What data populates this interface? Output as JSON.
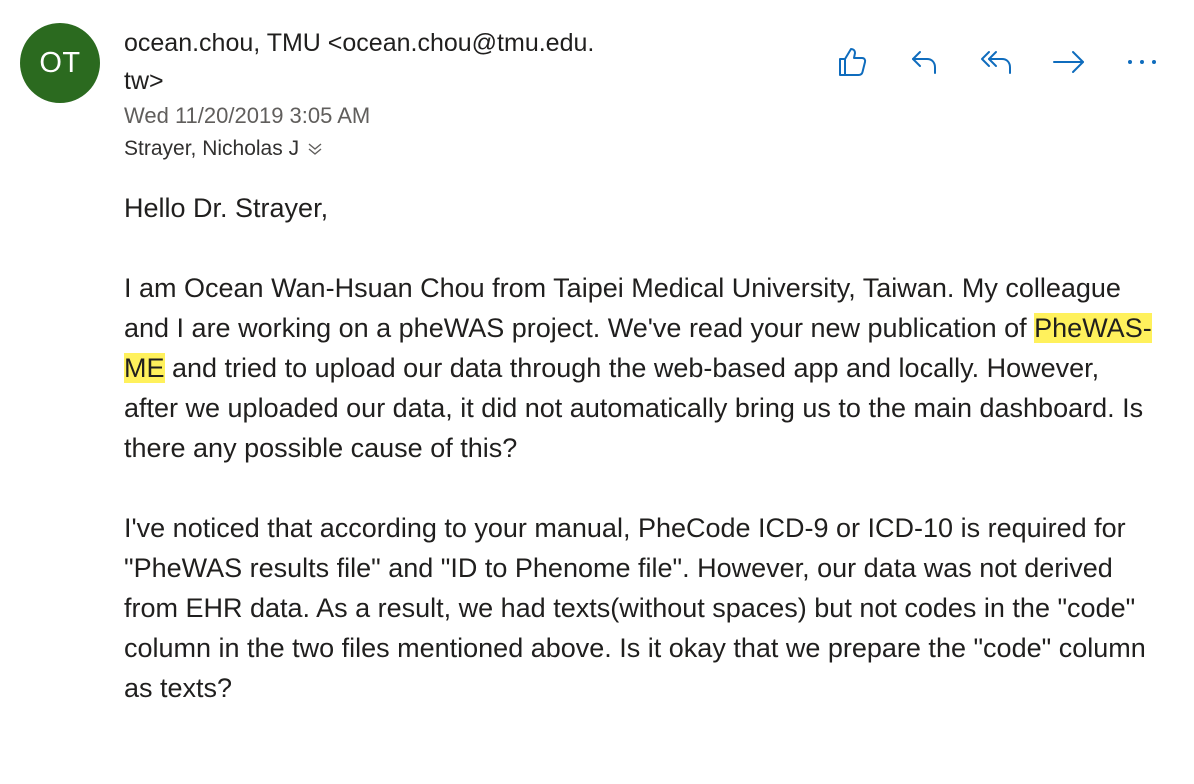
{
  "message": {
    "avatar_initials": "OT",
    "sender_line1": "ocean.chou, TMU <ocean.chou@tmu.edu.",
    "sender_line2": "tw>",
    "date": "Wed 11/20/2019 3:05 AM",
    "recipient": "Strayer, Nicholas J"
  },
  "actions": {
    "like": "like-icon",
    "reply": "reply-icon",
    "reply_all": "reply-all-icon",
    "forward": "forward-icon",
    "more": "more-icon"
  },
  "body": {
    "greeting": "Hello Dr. Strayer,",
    "p1_before": "I am Ocean Wan-Hsuan Chou from Taipei Medical University, Taiwan. My colleague and I are working on a pheWAS project. We've read your new publication of ",
    "p1_highlight": "PheWAS-ME",
    "p1_after": " and tried to upload our data through the web-based app and locally. However, after we uploaded our data, it did not automatically bring us to the main dashboard. Is there any possible cause of this?",
    "p2": "I've noticed that according to your manual, PheCode ICD-9 or ICD-10 is required for \"PheWAS results file\" and \"ID to Phenome file\". However, our data was not derived from EHR data. As a result, we had texts(without spaces) but not codes in the \"code\" column in the two files mentioned above. Is it okay that we prepare the \"code\" column as texts?"
  },
  "colors": {
    "avatar_bg": "#2b6a1f",
    "accent": "#0f6cbd",
    "highlight": "#fff15c"
  }
}
